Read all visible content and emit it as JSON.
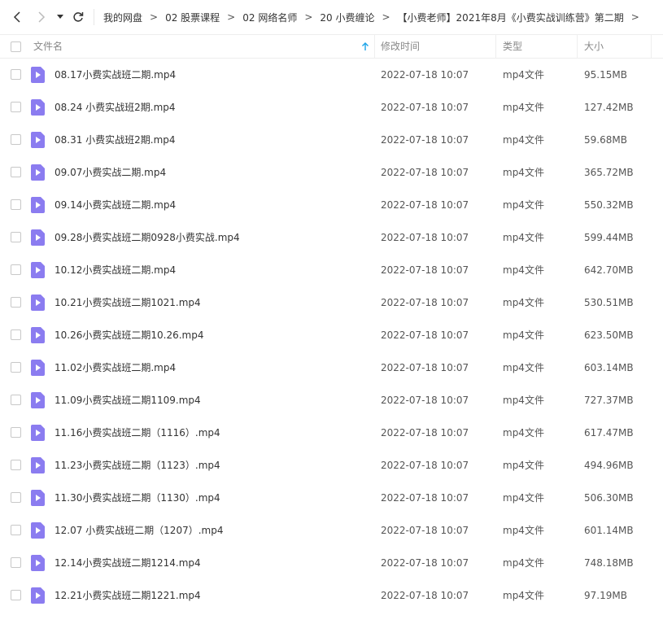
{
  "breadcrumb": [
    "我的网盘",
    "02 股票课程",
    "02 网络名师",
    "20 小费缠论",
    "【小费老师】2021年8月《小费实战训练营》第二期"
  ],
  "breadcrumb_separator": ">",
  "columns": {
    "name": "文件名",
    "modified": "修改时间",
    "type": "类型",
    "size": "大小"
  },
  "colors": {
    "file_icon": "#8b7cf0",
    "sort_arrow": "#1aa3e8"
  },
  "files": [
    {
      "name": "08.17小费实战班二期.mp4",
      "modified": "2022-07-18 10:07",
      "type": "mp4文件",
      "size": "95.15MB"
    },
    {
      "name": "08.24 小费实战班2期.mp4",
      "modified": "2022-07-18 10:07",
      "type": "mp4文件",
      "size": "127.42MB"
    },
    {
      "name": "08.31 小费实战班2期.mp4",
      "modified": "2022-07-18 10:07",
      "type": "mp4文件",
      "size": "59.68MB"
    },
    {
      "name": "09.07小费实战二期.mp4",
      "modified": "2022-07-18 10:07",
      "type": "mp4文件",
      "size": "365.72MB"
    },
    {
      "name": "09.14小费实战班二期.mp4",
      "modified": "2022-07-18 10:07",
      "type": "mp4文件",
      "size": "550.32MB"
    },
    {
      "name": "09.28小费实战班二期0928小费实战.mp4",
      "modified": "2022-07-18 10:07",
      "type": "mp4文件",
      "size": "599.44MB"
    },
    {
      "name": "10.12小费实战班二期.mp4",
      "modified": "2022-07-18 10:07",
      "type": "mp4文件",
      "size": "642.70MB"
    },
    {
      "name": "10.21小费实战班二期1021.mp4",
      "modified": "2022-07-18 10:07",
      "type": "mp4文件",
      "size": "530.51MB"
    },
    {
      "name": "10.26小费实战班二期10.26.mp4",
      "modified": "2022-07-18 10:07",
      "type": "mp4文件",
      "size": "623.50MB"
    },
    {
      "name": "11.02小费实战班二期.mp4",
      "modified": "2022-07-18 10:07",
      "type": "mp4文件",
      "size": "603.14MB"
    },
    {
      "name": "11.09小费实战班二期1109.mp4",
      "modified": "2022-07-18 10:07",
      "type": "mp4文件",
      "size": "727.37MB"
    },
    {
      "name": "11.16小费实战班二期（1116）.mp4",
      "modified": "2022-07-18 10:07",
      "type": "mp4文件",
      "size": "617.47MB"
    },
    {
      "name": "11.23小费实战班二期（1123）.mp4",
      "modified": "2022-07-18 10:07",
      "type": "mp4文件",
      "size": "494.96MB"
    },
    {
      "name": "11.30小费实战班二期（1130）.mp4",
      "modified": "2022-07-18 10:07",
      "type": "mp4文件",
      "size": "506.30MB"
    },
    {
      "name": "12.07 小费实战班二期（1207）.mp4",
      "modified": "2022-07-18 10:07",
      "type": "mp4文件",
      "size": "601.14MB"
    },
    {
      "name": "12.14小费实战班二期1214.mp4",
      "modified": "2022-07-18 10:07",
      "type": "mp4文件",
      "size": "748.18MB"
    },
    {
      "name": "12.21小费实战班二期1221.mp4",
      "modified": "2022-07-18 10:07",
      "type": "mp4文件",
      "size": "97.19MB"
    }
  ]
}
